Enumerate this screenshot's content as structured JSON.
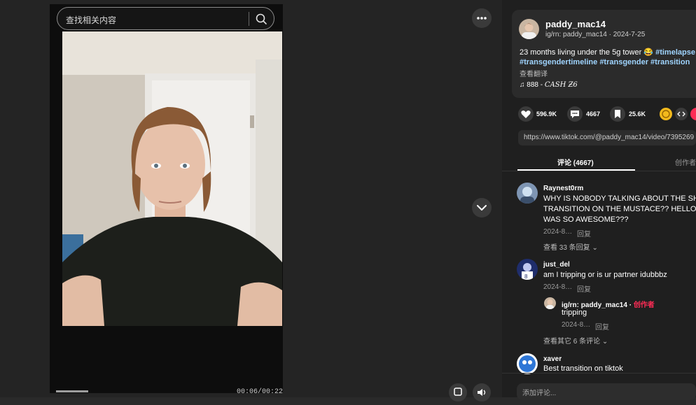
{
  "search": {
    "placeholder": "查找相关内容"
  },
  "player": {
    "time": "00:06/00:22"
  },
  "author": {
    "name": "paddy_mac14",
    "subtitle": "ig/rn: paddy_mac14 · 2024-7-25"
  },
  "description": {
    "line1_text": "23 months living under the 5g tower 😂 ",
    "line1_tag": "#timelapse",
    "line2": "#transgendertimeline #transgender #transition",
    "translate": "查看翻译"
  },
  "music": {
    "prefix": "888 - ",
    "title": "CASH Ƶ6"
  },
  "stats": {
    "likes": "596.9K",
    "comments": "4667",
    "saves": "25.6K"
  },
  "share_link": "https://www.tiktok.com/@paddy_mac14/video/7395269",
  "tabs": {
    "comments": "评论 (4667)",
    "creator": "创作者"
  },
  "comments": [
    {
      "user": "Raynest0rm",
      "lines": [
        "WHY IS NOBODY TALKING ABOUT THE SH",
        "TRANSITION ON THE MUSTACE?? HELLO",
        "WAS SO AWESOME???"
      ],
      "date": "2024-8…",
      "reply": "回复",
      "more": "查看 33 条回复"
    },
    {
      "user": "just_del",
      "lines": [
        "am I tripping or is ur partner idubbbz"
      ],
      "date": "2024-8…",
      "reply": "回复",
      "more": "查看其它 6 条评论"
    },
    {
      "user": "xaver",
      "lines": [
        "Best transition on tiktok"
      ]
    }
  ],
  "reply": {
    "user": "ig/rn: paddy_mac14 · ",
    "badge": "创作者",
    "text": "tripping",
    "date": "2024-8…",
    "reply": "回复"
  },
  "input": {
    "placeholder": "添加评论..."
  }
}
